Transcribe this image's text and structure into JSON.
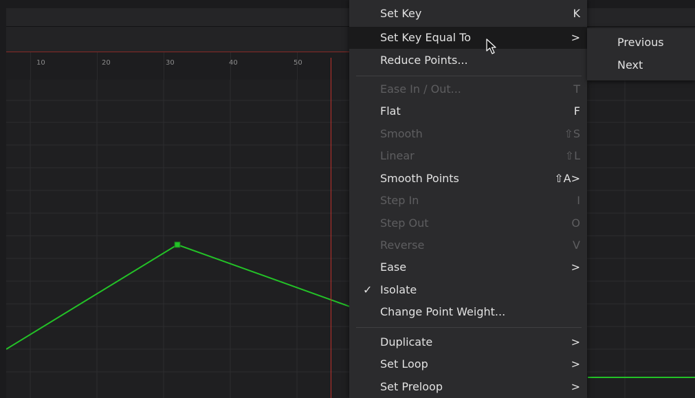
{
  "ruler": {
    "ticks": [
      "10",
      "20",
      "30",
      "40",
      "50"
    ]
  },
  "colors": {
    "curve": "#23c227",
    "playhead": "#c0312b",
    "menu_bg": "#2b2b2d"
  },
  "menu": {
    "items": [
      {
        "label": "Set Key",
        "shortcut": "K",
        "enabled": true
      },
      {
        "label": "Set Key Equal To",
        "shortcut": ">",
        "enabled": true,
        "highlighted": true
      },
      {
        "label": "Reduce Points...",
        "shortcut": "",
        "enabled": true
      },
      {
        "label": "Ease In / Out...",
        "shortcut": "T",
        "enabled": false
      },
      {
        "label": "Flat",
        "shortcut": "F",
        "enabled": true
      },
      {
        "label": "Smooth",
        "shortcut": "⇧S",
        "enabled": false
      },
      {
        "label": "Linear",
        "shortcut": "⇧L",
        "enabled": false
      },
      {
        "label": "Smooth Points",
        "shortcut": "⇧A>",
        "enabled": true
      },
      {
        "label": "Step In",
        "shortcut": "I",
        "enabled": false
      },
      {
        "label": "Step Out",
        "shortcut": "O",
        "enabled": false
      },
      {
        "label": "Reverse",
        "shortcut": "V",
        "enabled": false
      },
      {
        "label": "Ease",
        "shortcut": ">",
        "enabled": true
      },
      {
        "label": "Isolate",
        "shortcut": "",
        "enabled": true,
        "checked": true,
        "check": "✓"
      },
      {
        "label": "Change Point Weight...",
        "shortcut": "",
        "enabled": true
      },
      {
        "label": "Duplicate",
        "shortcut": ">",
        "enabled": true
      },
      {
        "label": "Set Loop",
        "shortcut": ">",
        "enabled": true
      },
      {
        "label": "Set Preloop",
        "shortcut": ">",
        "enabled": true
      }
    ]
  },
  "submenu": {
    "items": [
      "Previous",
      "Next"
    ]
  }
}
